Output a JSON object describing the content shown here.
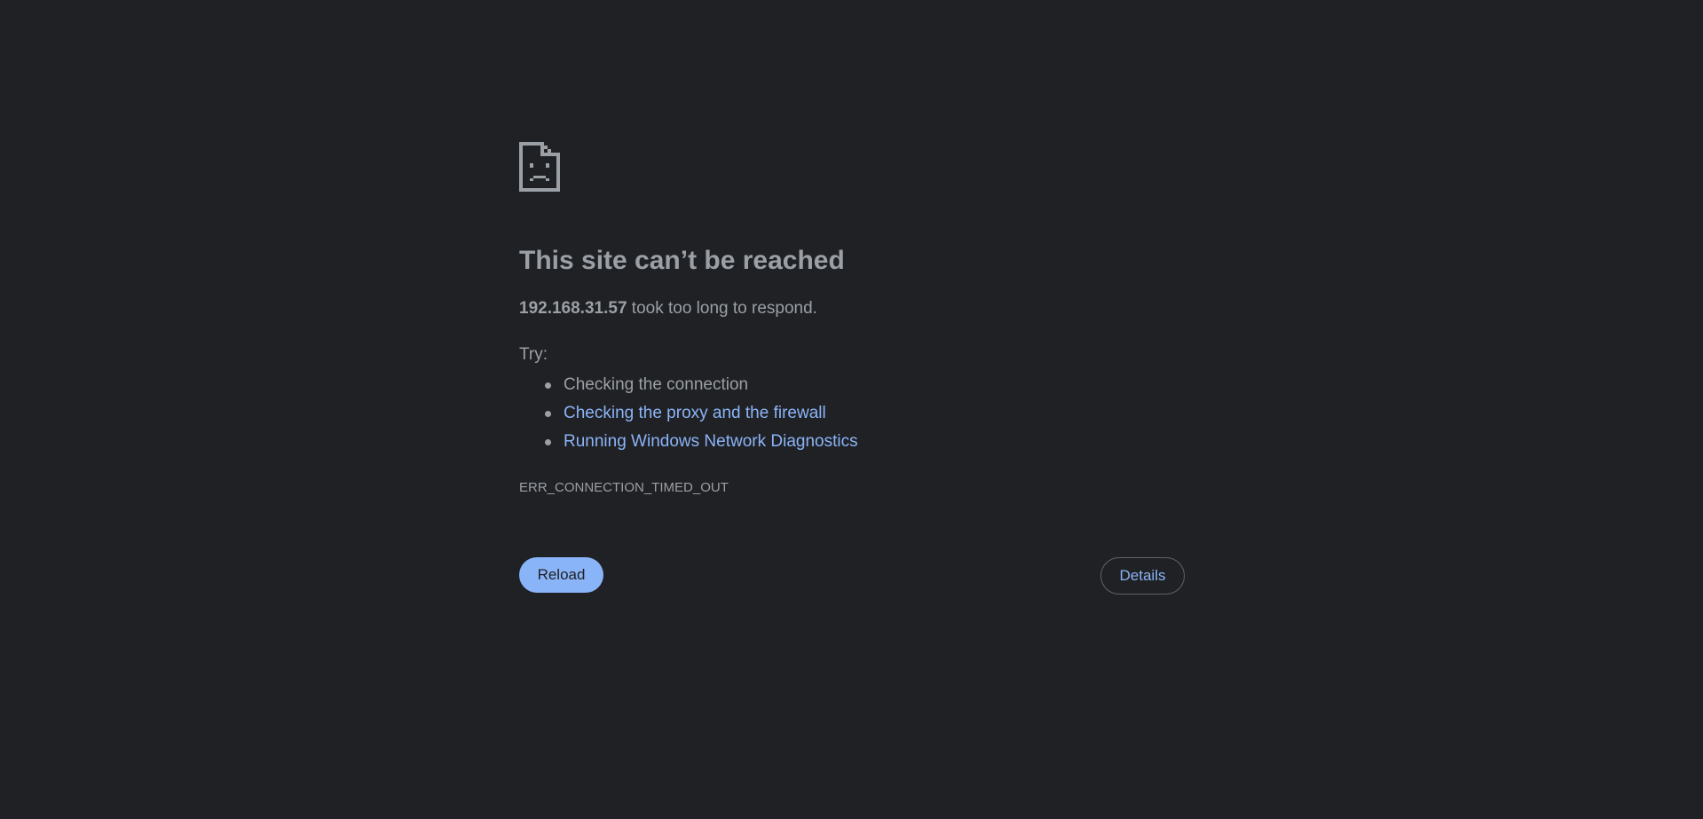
{
  "icon": "sad-document-icon",
  "colors": {
    "background": "#202124",
    "text": "#9aa0a6",
    "link": "#8ab4f8",
    "button_bg": "#8ab4f8",
    "button_text": "#202124",
    "border": "#5f6368"
  },
  "error": {
    "title": "This site can’t be reached",
    "host": "192.168.31.57",
    "summary_suffix": " took too long to respond.",
    "try_label": "Try:",
    "suggestions": [
      "Checking the connection",
      "Checking the proxy and the firewall",
      "Running Windows Network Diagnostics"
    ],
    "code": "ERR_CONNECTION_TIMED_OUT"
  },
  "buttons": {
    "reload_label": "Reload",
    "details_label": "Details"
  }
}
